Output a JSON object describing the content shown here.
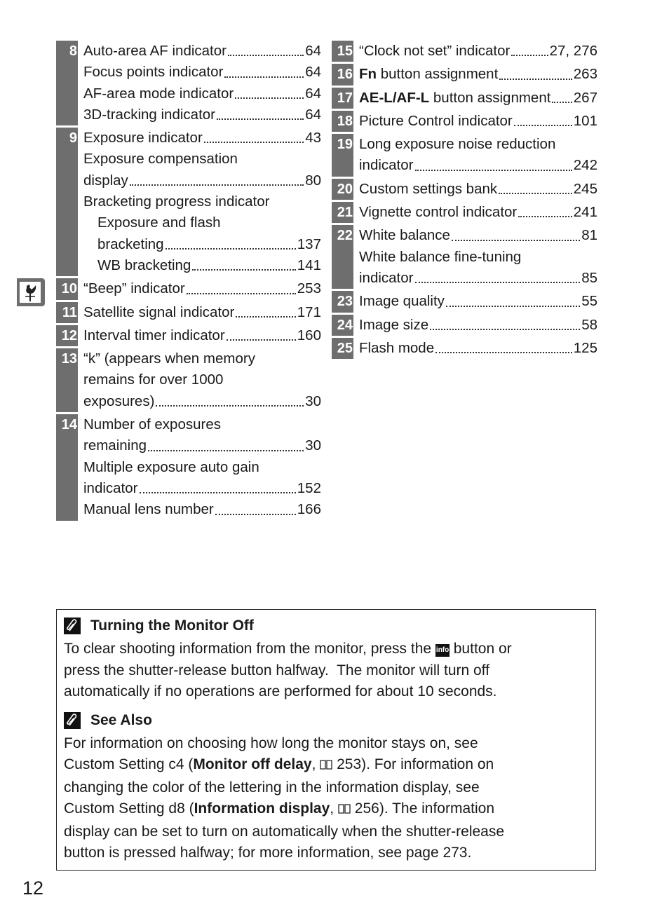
{
  "left_column": [
    {
      "number": "8",
      "lines": [
        {
          "text": "Auto-area AF indicator",
          "page": "64"
        },
        {
          "text": "Focus points indicator",
          "page": "64"
        },
        {
          "text": "AF-area mode indicator",
          "page": "64"
        },
        {
          "text": "3D-tracking indicator",
          "page": "64"
        }
      ]
    },
    {
      "number": "9",
      "lines": [
        {
          "text": "Exposure indicator",
          "page": "43"
        },
        {
          "text": "Exposure compensation"
        },
        {
          "text": "display",
          "page": "80"
        },
        {
          "text": "Bracketing progress indicator"
        },
        {
          "text": "Exposure and flash",
          "indent": true
        },
        {
          "text": "bracketing",
          "page": "137",
          "indent": true
        },
        {
          "text": "WB bracketing",
          "page": "141",
          "indent": true
        }
      ]
    },
    {
      "number": "10",
      "lines": [
        {
          "text": "“Beep” indicator",
          "page": "253"
        }
      ]
    },
    {
      "number": "11",
      "lines": [
        {
          "text": "Satellite signal indicator",
          "page": "171"
        }
      ]
    },
    {
      "number": "12",
      "lines": [
        {
          "text": "Interval timer indicator",
          "page": "160"
        }
      ]
    },
    {
      "number": "13",
      "lines": [
        {
          "text": "“k” (appears when memory"
        },
        {
          "text": "remains for over 1000"
        },
        {
          "text": "exposures)",
          "page": "30"
        }
      ]
    },
    {
      "number": "14",
      "lines": [
        {
          "text": "Number of exposures"
        },
        {
          "text": "remaining",
          "page": "30"
        },
        {
          "text": "Multiple exposure auto gain"
        },
        {
          "text": "indicator",
          "page": "152"
        },
        {
          "text": "Manual lens number",
          "page": "166"
        }
      ]
    }
  ],
  "right_column": [
    {
      "number": "15",
      "lines": [
        {
          "text": "“Clock not set” indicator",
          "page": "27, 276"
        }
      ]
    },
    {
      "number": "16",
      "lines": [
        {
          "bold": "Fn",
          "text": " button assignment",
          "page": "263"
        }
      ]
    },
    {
      "number": "17",
      "lines": [
        {
          "bold": "AE-L/AF-L",
          "text": " button assignment",
          "page": "267"
        }
      ]
    },
    {
      "number": "18",
      "lines": [
        {
          "text": "Picture Control indicator",
          "page": "101"
        }
      ]
    },
    {
      "number": "19",
      "lines": [
        {
          "text": "Long exposure noise reduction"
        },
        {
          "text": "indicator",
          "page": "242"
        }
      ]
    },
    {
      "number": "20",
      "lines": [
        {
          "text": "Custom settings bank",
          "page": "245"
        }
      ]
    },
    {
      "number": "21",
      "lines": [
        {
          "text": "Vignette control indicator",
          "page": "241"
        }
      ]
    },
    {
      "number": "22",
      "lines": [
        {
          "text": "White balance",
          "page": "81"
        },
        {
          "text": "White balance fine-tuning"
        },
        {
          "text": "indicator",
          "page": "85"
        }
      ]
    },
    {
      "number": "23",
      "lines": [
        {
          "text": "Image quality",
          "page": "55"
        }
      ]
    },
    {
      "number": "24",
      "lines": [
        {
          "text": "Image size",
          "page": "58"
        }
      ]
    },
    {
      "number": "25",
      "lines": [
        {
          "text": "Flash mode",
          "page": "125"
        }
      ]
    }
  ],
  "side_tab_icon": "weathervane-rooster-icon",
  "notes": [
    {
      "title": "Turning the Monitor Off",
      "icon": "paperclip-icon",
      "lines": [
        [
          {
            "t": "To clear shooting information from the monitor, press the "
          },
          {
            "icon": "info"
          },
          {
            "t": " button or"
          }
        ],
        [
          {
            "t": "press the shutter-release button halfway.  The monitor will turn off"
          }
        ],
        [
          {
            "t": "automatically if no operations are performed for about 10 seconds."
          }
        ]
      ]
    },
    {
      "title": "See Also",
      "icon": "paperclip-icon",
      "lines": [
        [
          {
            "t": "For information on choosing how long the monitor stays on, see"
          }
        ],
        [
          {
            "t": "Custom Setting c4 ("
          },
          {
            "b": "Monitor off delay"
          },
          {
            "t": ", "
          },
          {
            "icon": "book"
          },
          {
            "t": " 253). For information on"
          }
        ],
        [
          {
            "t": "changing the color of the lettering in the information display, see"
          }
        ],
        [
          {
            "t": "Custom Setting d8 ("
          },
          {
            "b": "Information display"
          },
          {
            "t": ", "
          },
          {
            "icon": "book"
          },
          {
            "t": " 256). The information"
          }
        ],
        [
          {
            "t": "display can be set to turn on automatically when the shutter-release"
          }
        ],
        [
          {
            "t": "button is pressed halfway; for more information, see page 273."
          }
        ]
      ]
    }
  ],
  "page_number": "12"
}
